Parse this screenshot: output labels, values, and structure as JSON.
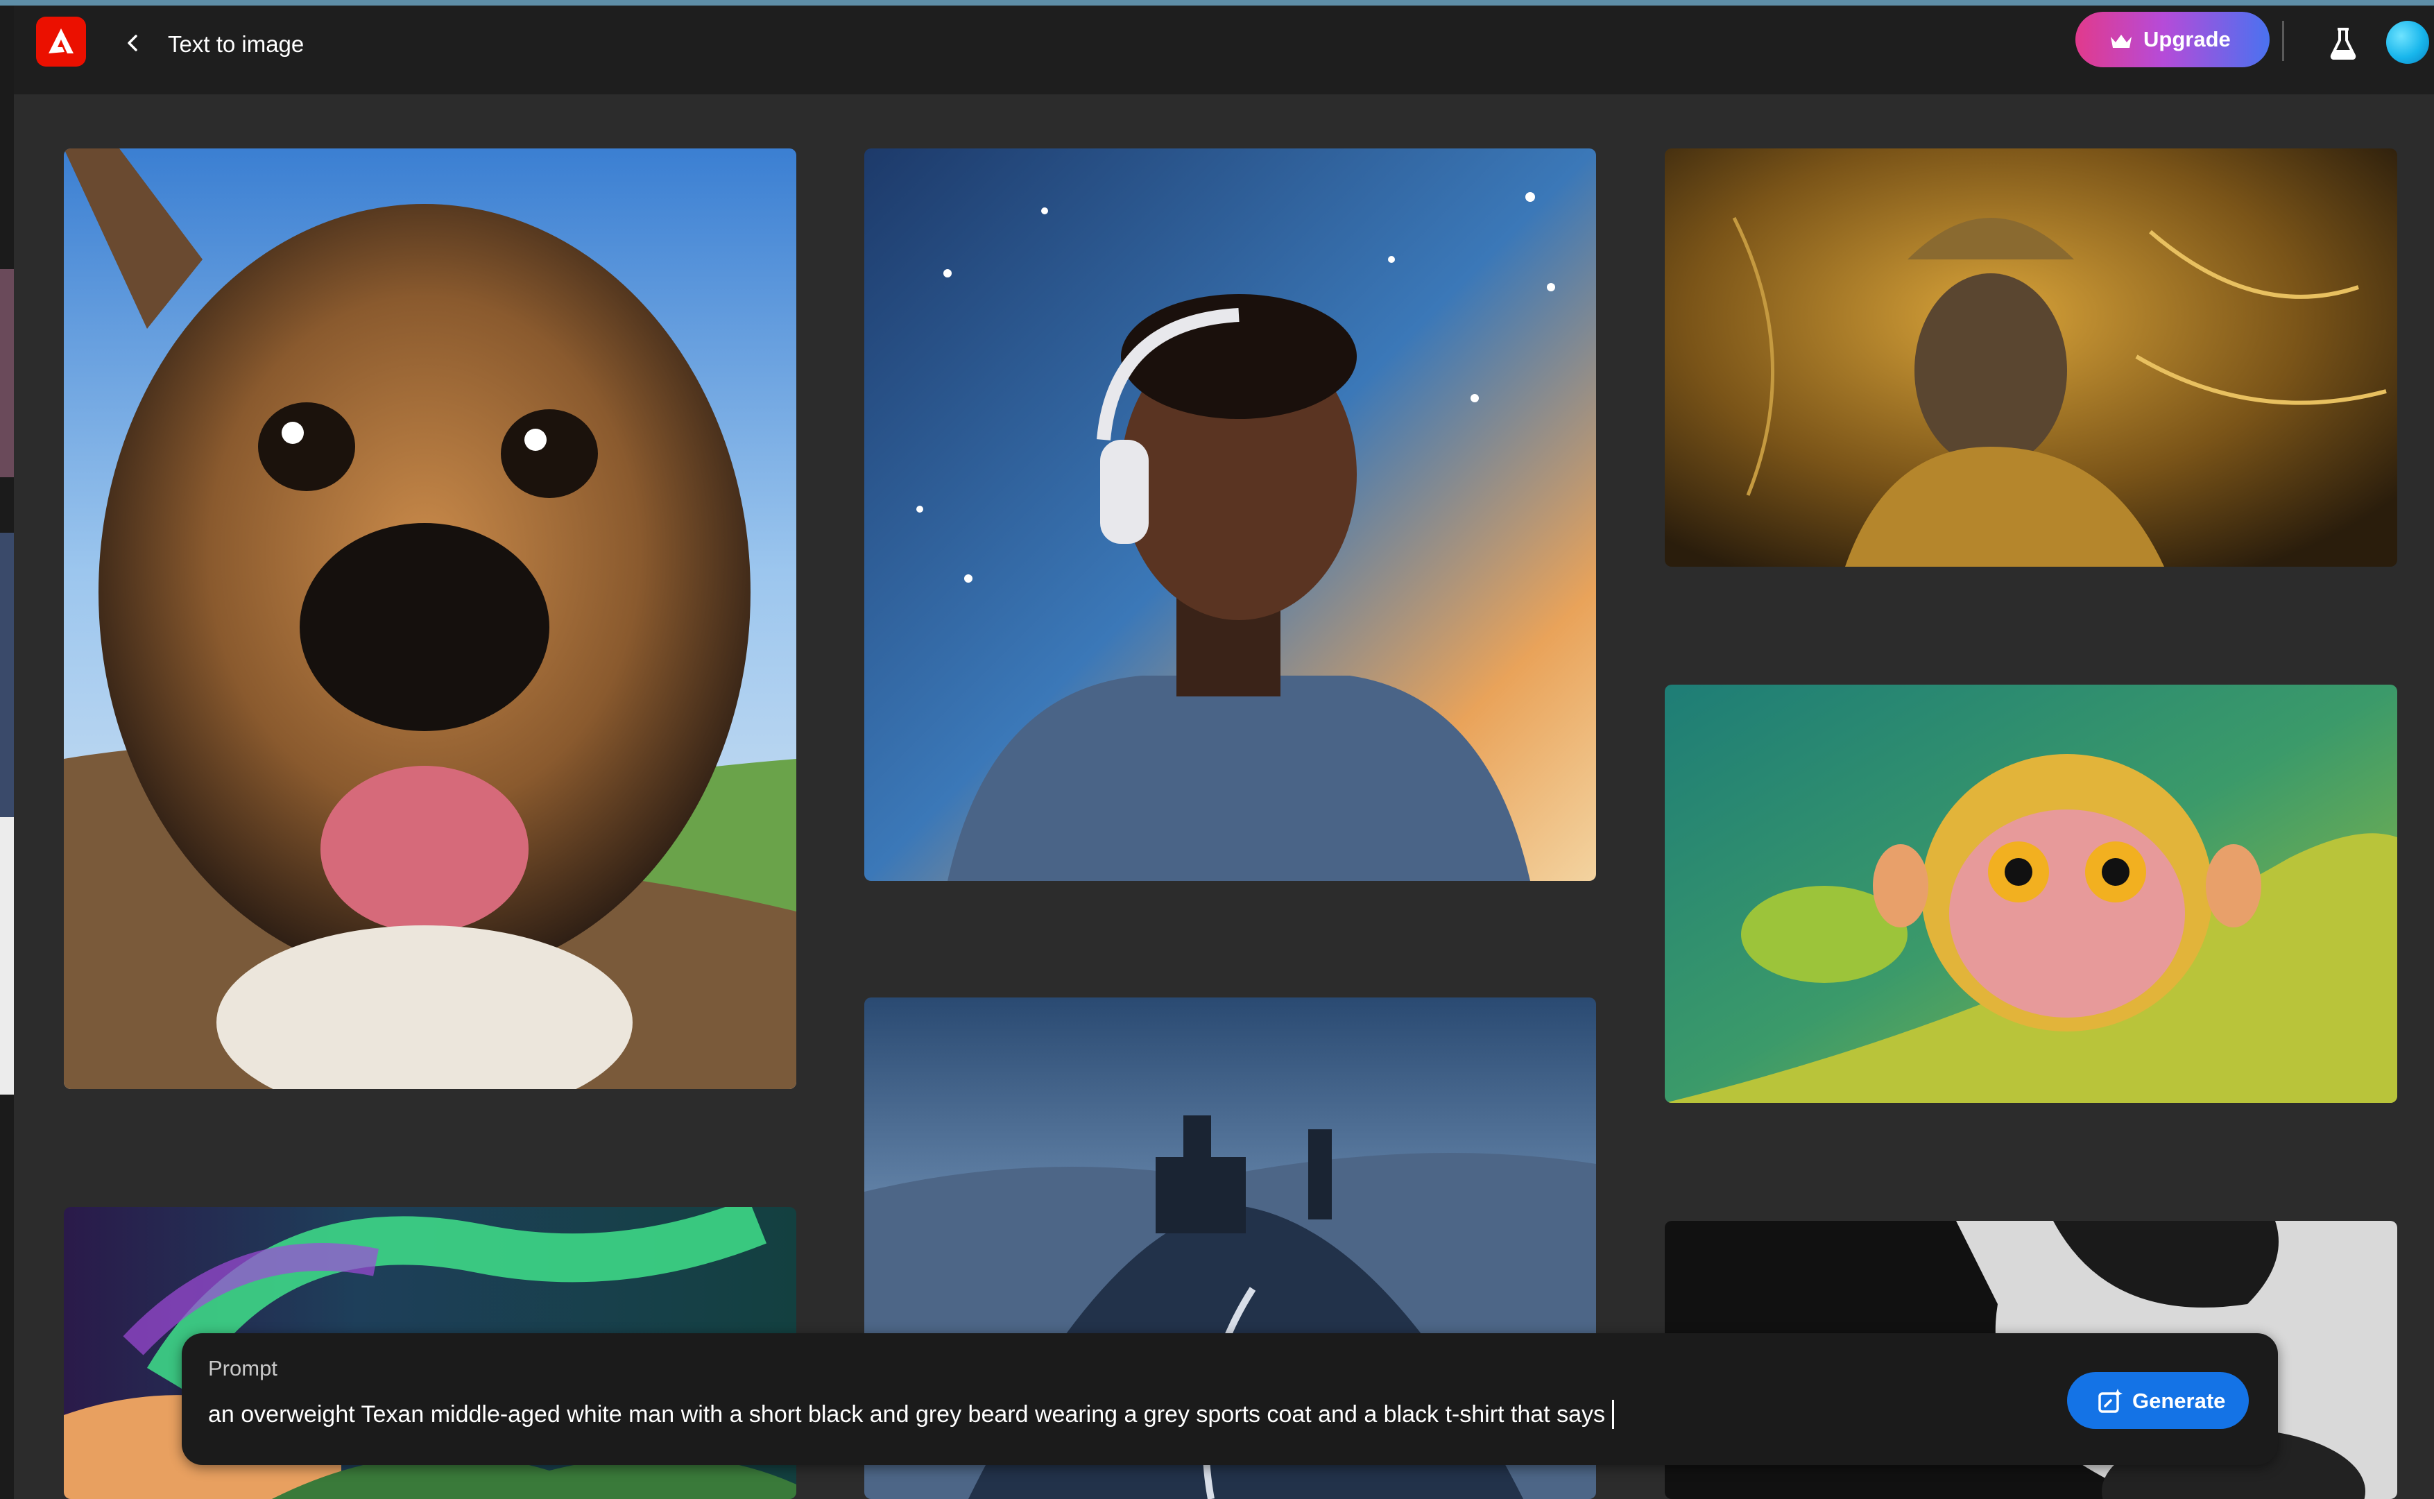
{
  "header": {
    "app_logo": "adobe-logo-icon",
    "back_icon": "chevron-left-icon",
    "title": "Text to image",
    "upgrade_label": "Upgrade",
    "upgrade_icon": "crown-icon",
    "labs_icon": "beaker-icon",
    "avatar_icon": "profile-avatar"
  },
  "gallery": {
    "tiles": [
      {
        "subject": "puppy"
      },
      {
        "subject": "man-with-headphones"
      },
      {
        "subject": "golden-figure"
      },
      {
        "subject": "monkey"
      },
      {
        "subject": "castle"
      },
      {
        "subject": "aurora"
      },
      {
        "subject": "panda"
      }
    ]
  },
  "prompt_bar": {
    "label": "Prompt",
    "value": "an overweight Texan middle-aged white man with a short black and grey beard wearing a grey sports coat and a black t-shirt that says",
    "generate_label": "Generate",
    "generate_icon": "generate-sparkle-icon"
  },
  "colors": {
    "brand_red": "#eb1000",
    "generate_blue": "#1473e6",
    "page_bg": "#2c2c2c",
    "header_bg": "#1e1e1e"
  }
}
